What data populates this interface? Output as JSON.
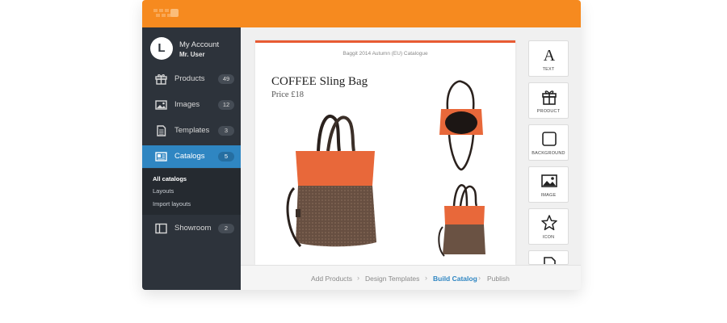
{
  "colors": {
    "accent": "#f68a1f",
    "active": "#2f86c2",
    "sidebar": "#2d333b",
    "page_rule": "#e85b33"
  },
  "account": {
    "initial": "L",
    "title": "My Account",
    "user": "Mr. User"
  },
  "sidebar": {
    "items": [
      {
        "label": "Products",
        "count": "49",
        "icon": "gift-icon"
      },
      {
        "label": "Images",
        "count": "12",
        "icon": "image-icon"
      },
      {
        "label": "Templates",
        "count": "3",
        "icon": "document-icon"
      },
      {
        "label": "Catalogs",
        "count": "5",
        "icon": "catalog-icon"
      },
      {
        "label": "Showroom",
        "count": "2",
        "icon": "showroom-icon"
      }
    ],
    "subitems": [
      "All catalogs",
      "Layouts",
      "Import layouts"
    ]
  },
  "page": {
    "header": "Baggit 2014 Autumn (EU) Catalogue",
    "product_title": "COFFEE Sling Bag",
    "price": "Price £18"
  },
  "tools": [
    {
      "label": "TEXT",
      "icon": "text-icon"
    },
    {
      "label": "PRODUCT",
      "icon": "gift-icon"
    },
    {
      "label": "BACKGROUND",
      "icon": "square-icon"
    },
    {
      "label": "IMAGE",
      "icon": "image-icon"
    },
    {
      "label": "ICON",
      "icon": "star-icon"
    },
    {
      "label": "",
      "icon": "page-icon"
    }
  ],
  "breadcrumbs": [
    "Add Products",
    "Design Templates",
    "Build Catalog",
    "Publish"
  ]
}
